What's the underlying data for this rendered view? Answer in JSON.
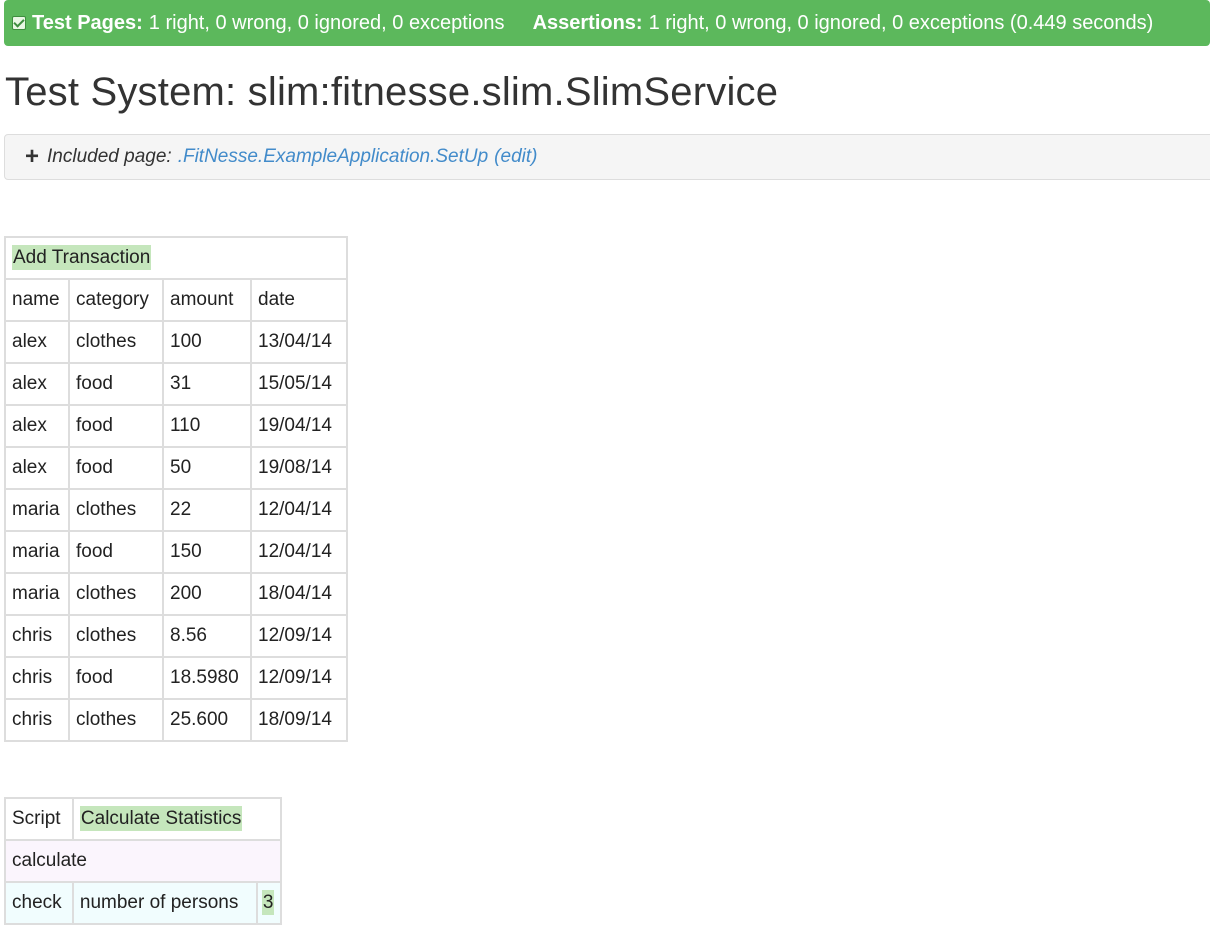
{
  "status": {
    "test_pages_label": "Test Pages:",
    "test_pages_value": "1 right, 0 wrong, 0 ignored, 0 exceptions",
    "assertions_label": "Assertions:",
    "assertions_value": "1 right, 0 wrong, 0 ignored, 0 exceptions (0.449 seconds)",
    "color": "#5cb85c"
  },
  "title": "Test System: slim:fitnesse.slim.SlimService",
  "included": {
    "prefix": "Included page:",
    "link": ".FitNesse.ExampleApplication.SetUp",
    "edit": "(edit)"
  },
  "transactions": {
    "title": "Add Transaction",
    "headers": [
      "name",
      "category",
      "amount",
      "date"
    ],
    "rows": [
      [
        "alex",
        "clothes",
        "100",
        "13/04/14"
      ],
      [
        "alex",
        "food",
        "31",
        "15/05/14"
      ],
      [
        "alex",
        "food",
        "110",
        "19/04/14"
      ],
      [
        "alex",
        "food",
        "50",
        "19/08/14"
      ],
      [
        "maria",
        "clothes",
        "22",
        "12/04/14"
      ],
      [
        "maria",
        "food",
        "150",
        "12/04/14"
      ],
      [
        "maria",
        "clothes",
        "200",
        "18/04/14"
      ],
      [
        "chris",
        "clothes",
        "8.56",
        "12/09/14"
      ],
      [
        "chris",
        "food",
        "18.5980",
        "12/09/14"
      ],
      [
        "chris",
        "clothes",
        "25.600",
        "18/09/14"
      ]
    ]
  },
  "script": {
    "keyword": "Script",
    "name": "Calculate Statistics",
    "action": "calculate",
    "check_keyword": "check",
    "check_label": "number of persons",
    "check_value": "3"
  }
}
